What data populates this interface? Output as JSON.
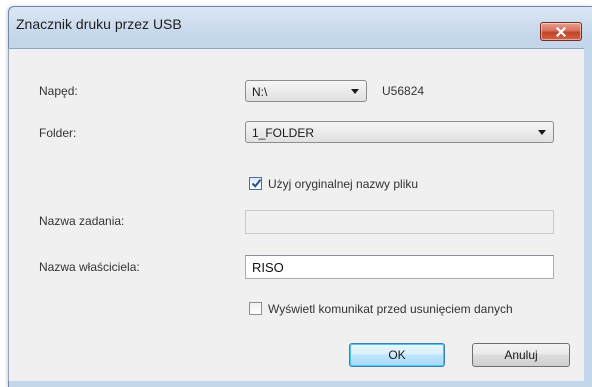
{
  "window": {
    "title": "Znacznik druku przez USB"
  },
  "drive": {
    "label": "Napęd:",
    "selected": "N:\\",
    "volume_name": "U56824"
  },
  "folder": {
    "label": "Folder:",
    "selected": "1_FOLDER"
  },
  "use_original_filename": {
    "label": "Użyj oryginalnej nazwy pliku",
    "checked": true
  },
  "job_name": {
    "label": "Nazwa zadania:",
    "value": "",
    "enabled": false
  },
  "owner_name": {
    "label": "Nazwa właściciela:",
    "value": "RISO"
  },
  "show_message": {
    "label": "Wyświetl komunikat przed usunięciem danych",
    "checked": false
  },
  "buttons": {
    "ok": "OK",
    "cancel": "Anuluj"
  },
  "icons": {
    "close": "close-icon",
    "dropdown": "chevron-down-icon",
    "check": "checkmark-icon"
  }
}
